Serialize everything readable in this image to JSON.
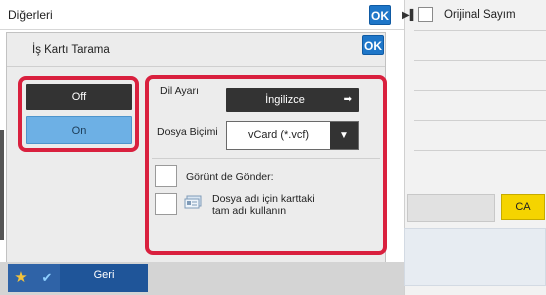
{
  "window": {
    "title": "Diğerleri",
    "ok_label": "OK"
  },
  "dialog": {
    "title": "İş Kartı Tarama",
    "ok_label": "OK"
  },
  "toggle": {
    "off_label": "Off",
    "on_label": "On",
    "selected": "On"
  },
  "settings": {
    "language_label": "Dil Ayarı",
    "language_value": "İngilizce",
    "format_label": "Dosya Biçimi",
    "format_value": "vCard (*.vcf)",
    "send_image_label": "Görünt de Gönder:",
    "send_image_checked": false,
    "use_card_name_label": "Dosya adı için karttaki tam adı kullanın",
    "use_card_name_checked": false
  },
  "right_panel": {
    "original_count_label": "Orijinal Sayım",
    "original_count_checked": false,
    "ca_label": "CA"
  },
  "bottom": {
    "back_label": "Geri"
  },
  "colors": {
    "highlight": "#d9203e",
    "ok_blue": "#1e76c8",
    "on_blue": "#6db0e5",
    "ca_yellow": "#f5d400"
  },
  "icons": {
    "play": "play-arrow-icon",
    "star": "star-icon",
    "check": "check-icon",
    "card": "business-card-icon",
    "dropdown": "triangle-down-icon"
  }
}
